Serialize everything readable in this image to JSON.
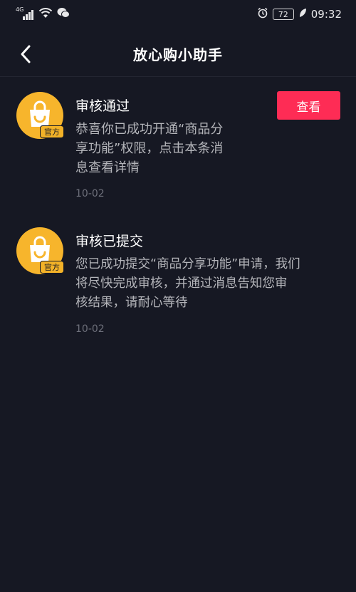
{
  "status_bar": {
    "network": "4G",
    "battery": "72",
    "time": "09:32"
  },
  "header": {
    "title": "放心购小助手"
  },
  "messages": [
    {
      "title": "审核通过",
      "body_lines": [
        "恭喜你已成功开通“商品分",
        "享功能”权限，点击本条消",
        "息查看详情"
      ],
      "date": "10-02",
      "badge": "官方",
      "button": "查看"
    },
    {
      "title": "审核已提交",
      "body_lines": [
        "您已成功提交“商品分享功能”申请，我们",
        "将尽快完成审核，并通过消息告知您审",
        "核结果，请耐心等待"
      ],
      "date": "10-02",
      "badge": "官方"
    }
  ],
  "colors": {
    "background": "#161823",
    "accent": "#fe2c55",
    "avatar": "#f7b52c"
  }
}
